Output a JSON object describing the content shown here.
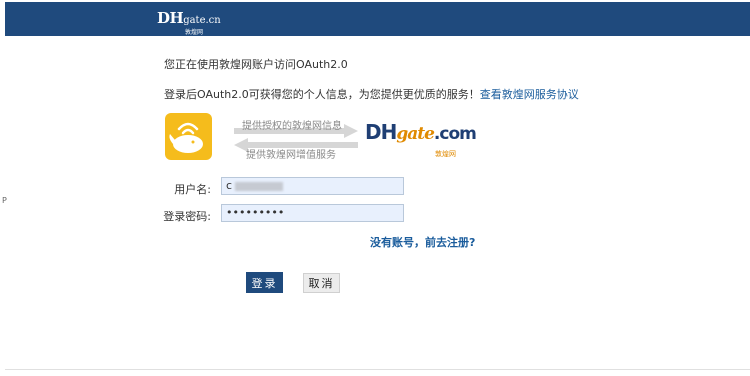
{
  "header": {
    "logo_main": "DHgate.cn",
    "logo_sub": "敦煌网",
    "bar_color": "#1f4a7d"
  },
  "intro": {
    "line1": "您正在使用敦煌网账户访问OAuth2.0",
    "line2": "登录后OAuth2.0可获得您的个人信息，为您提供更优质的服务！",
    "agreement_link": "查看敦煌网服务协议"
  },
  "graphic": {
    "app_icon": "whale-app-icon",
    "arrow_top_text": "提供授权的敦煌网信息",
    "arrow_bottom_text": "提供敦煌网增值服务",
    "brand_logo": "DHgate.com",
    "brand_sub": "敦煌网"
  },
  "form": {
    "username_label": "用户名:",
    "username_value": "c",
    "password_label": "登录密码:",
    "password_value": "•••••••••",
    "register_link": "没有账号，前去注册?"
  },
  "actions": {
    "login_label": "登录",
    "cancel_label": "取消"
  },
  "edge_char": "P"
}
